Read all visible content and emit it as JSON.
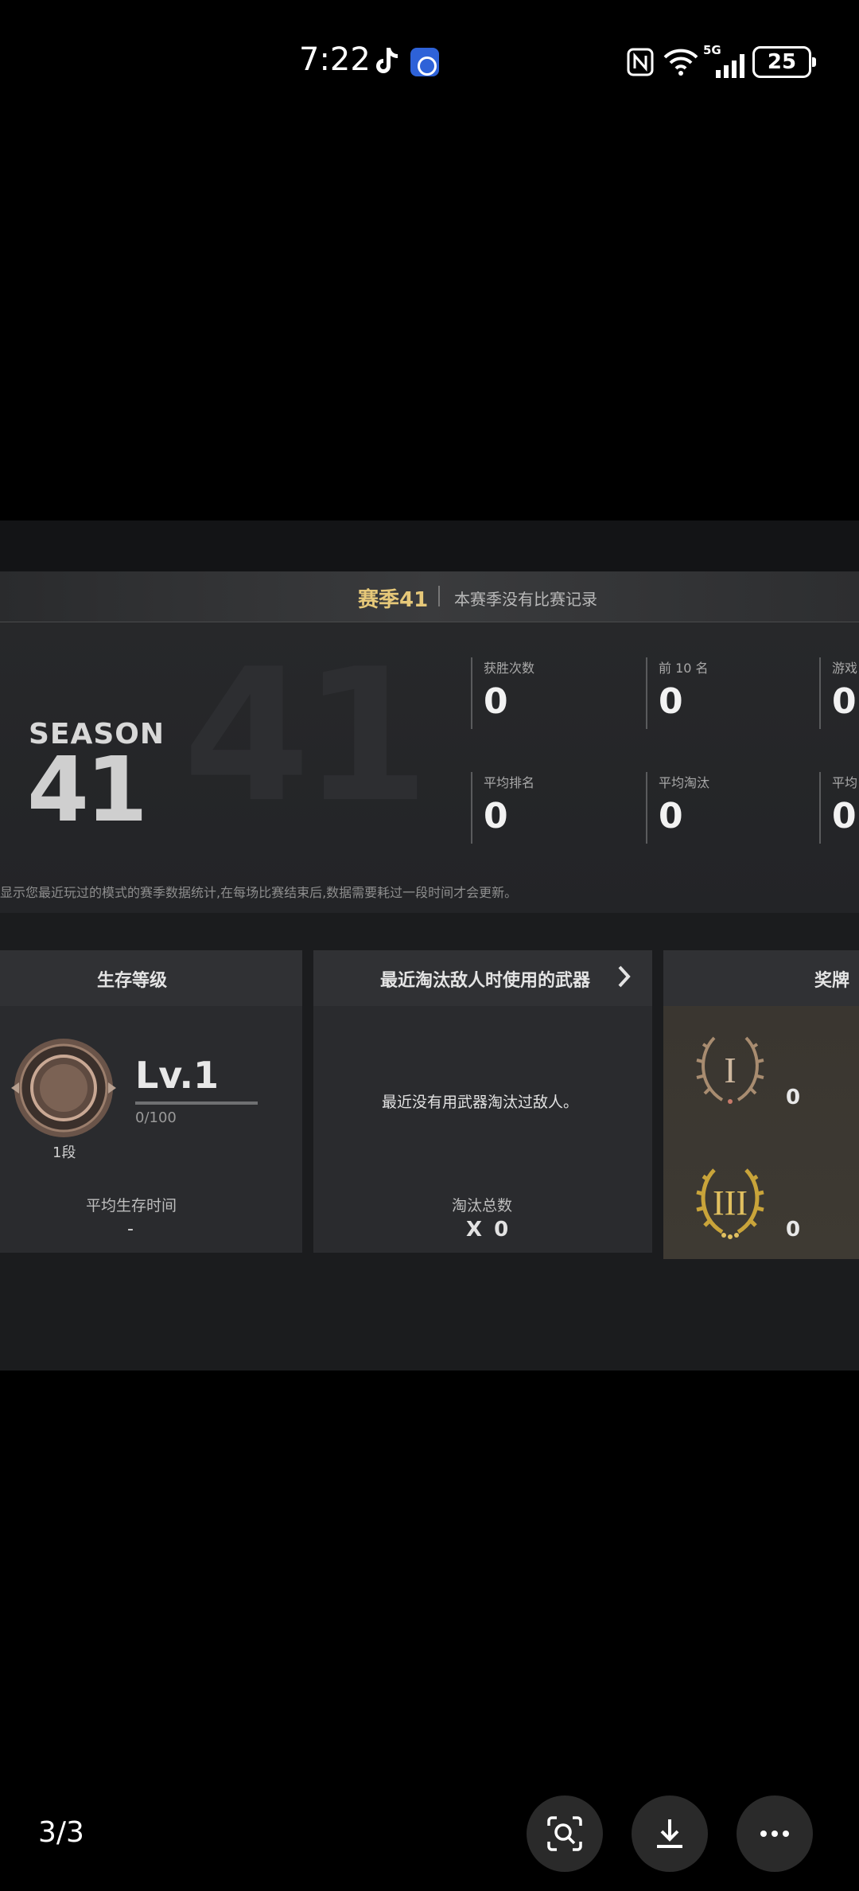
{
  "status_bar": {
    "time": "7:22",
    "network": "5G",
    "battery": "25",
    "icons": [
      "tiktok-icon",
      "app-icon",
      "nfc-icon",
      "wifi-icon",
      "signal-icon",
      "battery-icon"
    ]
  },
  "game": {
    "season_header_title": "赛季41",
    "season_header_subtitle": "本赛季没有比赛记录",
    "season_word": "SEASON",
    "season_number": "41",
    "stats": [
      {
        "label": "获胜次数",
        "value": "0"
      },
      {
        "label": "前 10 名",
        "value": "0"
      },
      {
        "label": "游戏",
        "value": "0"
      },
      {
        "label": "平均排名",
        "value": "0"
      },
      {
        "label": "平均淘汰",
        "value": "0"
      },
      {
        "label": "平均",
        "value": "0"
      }
    ],
    "note": "显示您最近玩过的模式的赛季数据统计,在每场比赛结束后,数据需要耗过一段时间才会更新。",
    "panel_survival": {
      "title": "生存等级",
      "level": "Lv.1",
      "xp": "0/100",
      "tier": "1段",
      "sub_label": "平均生存时间",
      "sub_value": "-"
    },
    "panel_weapon": {
      "title": "最近淘汰敌人时使用的武器",
      "message": "最近没有用武器淘汰过敌人。",
      "label": "淘汰总数",
      "value": "X 0"
    },
    "panel_medals": {
      "title": "奖牌",
      "medals": [
        {
          "numeral": "I",
          "count": "0"
        },
        {
          "numeral": "III",
          "count": "0"
        }
      ]
    }
  },
  "bottom_bar": {
    "pager": "3/3",
    "buttons": [
      "search-lens-icon",
      "download-icon",
      "more-icon"
    ]
  },
  "colors": {
    "background": "#000000",
    "gold_accent": "#e6c879",
    "panel": "#2a2b2e"
  }
}
